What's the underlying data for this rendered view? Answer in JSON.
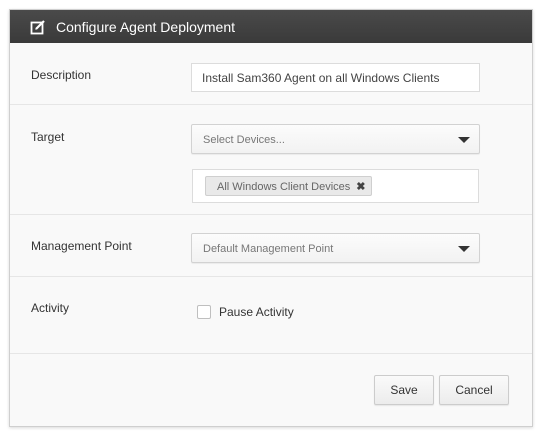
{
  "dialog": {
    "title": "Configure Agent Deployment",
    "title_icon": "edit-icon"
  },
  "description": {
    "label": "Description",
    "value": "Install Sam360 Agent on all Windows Clients"
  },
  "target": {
    "label": "Target",
    "select_placeholder": "Select Devices...",
    "tags": [
      {
        "label": "All Windows Client Devices",
        "remove_icon": "close-icon"
      }
    ]
  },
  "management_point": {
    "label": "Management Point",
    "selected": "Default Management Point"
  },
  "activity": {
    "label": "Activity",
    "checkbox_label": "Pause Activity",
    "checked": false
  },
  "footer": {
    "save_label": "Save",
    "cancel_label": "Cancel"
  }
}
